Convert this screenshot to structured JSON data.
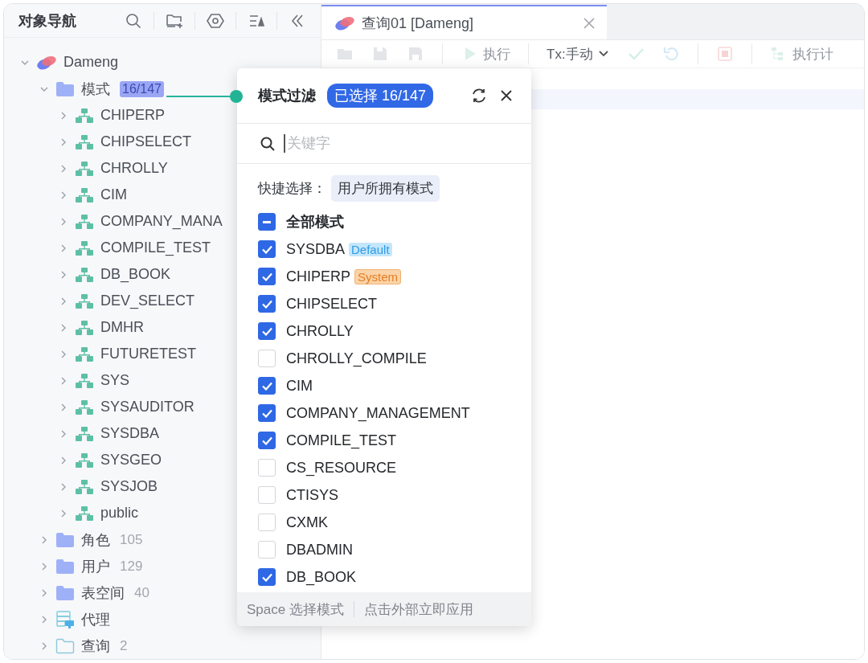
{
  "nav": {
    "title": "对象导航",
    "tree": [
      {
        "label": "Dameng",
        "kind": "database",
        "expanded": true,
        "children": [
          {
            "label": "模式",
            "kind": "folder",
            "badge": "16/147",
            "expanded": true,
            "children": [
              {
                "label": "CHIPERP",
                "kind": "schema",
                "expanded": false
              },
              {
                "label": "CHIPSELECT",
                "kind": "schema",
                "expanded": false
              },
              {
                "label": "CHROLLY",
                "kind": "schema",
                "expanded": false
              },
              {
                "label": "CIM",
                "kind": "schema",
                "expanded": false
              },
              {
                "label": "COMPANY_MANA",
                "kind": "schema",
                "expanded": false
              },
              {
                "label": "COMPILE_TEST",
                "kind": "schema",
                "expanded": false
              },
              {
                "label": "DB_BOOK",
                "kind": "schema",
                "expanded": false
              },
              {
                "label": "DEV_SELECT",
                "kind": "schema",
                "expanded": false
              },
              {
                "label": "DMHR",
                "kind": "schema",
                "expanded": false
              },
              {
                "label": "FUTURETEST",
                "kind": "schema",
                "expanded": false
              },
              {
                "label": "SYS",
                "kind": "schema",
                "expanded": false
              },
              {
                "label": "SYSAUDITOR",
                "kind": "schema",
                "expanded": false
              },
              {
                "label": "SYSDBA",
                "kind": "schema",
                "expanded": false
              },
              {
                "label": "SYSGEO",
                "kind": "schema",
                "expanded": false
              },
              {
                "label": "SYSJOB",
                "kind": "schema",
                "expanded": false
              },
              {
                "label": "public",
                "kind": "schema",
                "expanded": false
              }
            ]
          },
          {
            "label": "角色",
            "kind": "folder",
            "count": "105",
            "expanded": false
          },
          {
            "label": "用户",
            "kind": "folder",
            "count": "129",
            "expanded": false
          },
          {
            "label": "表空间",
            "kind": "folder",
            "count": "40",
            "expanded": false
          },
          {
            "label": "代理",
            "kind": "server",
            "expanded": false
          },
          {
            "label": "查询",
            "kind": "outline-folder",
            "count": "2",
            "expanded": false
          }
        ]
      }
    ]
  },
  "tabs": [
    {
      "label": "查询01 [Dameng]",
      "selected": true
    }
  ],
  "toolbar": [
    {
      "kind": "open",
      "disabled": true
    },
    {
      "kind": "save",
      "disabled": true
    },
    {
      "kind": "save-all",
      "disabled": true
    },
    {
      "kind": "run",
      "label": "执行",
      "disabled": true
    },
    {
      "kind": "tx",
      "label": "Tx:手动",
      "disabled": false
    },
    {
      "kind": "commit",
      "disabled": true
    },
    {
      "kind": "rollback",
      "disabled": true
    },
    {
      "kind": "stop",
      "disabled": true
    },
    {
      "kind": "plan",
      "label": "执行计",
      "disabled": true
    }
  ],
  "popup": {
    "title": "模式过滤",
    "badge": "已选择 16/147",
    "search": {
      "placeholder": "关键字"
    },
    "quick_label": "快捷选择：",
    "quick_options": [
      "用户所拥有模式"
    ],
    "all": {
      "label": "全部模式",
      "indeterminate": true
    },
    "items": [
      {
        "label": "SYSDBA",
        "checked": true,
        "tag": {
          "text": "Default",
          "kind": "default"
        }
      },
      {
        "label": "CHIPERP",
        "checked": true,
        "tag": {
          "text": "System",
          "kind": "system"
        }
      },
      {
        "label": "CHIPSELECT",
        "checked": true
      },
      {
        "label": "CHROLLY",
        "checked": true
      },
      {
        "label": "CHROLLY_COMPILE",
        "checked": false
      },
      {
        "label": "CIM",
        "checked": true
      },
      {
        "label": "COMPANY_MANAGEMENT",
        "checked": true
      },
      {
        "label": "COMPILE_TEST",
        "checked": true
      },
      {
        "label": "CS_RESOURCE",
        "checked": false
      },
      {
        "label": "CTISYS",
        "checked": false
      },
      {
        "label": "CXMK",
        "checked": false
      },
      {
        "label": "DBADMIN",
        "checked": false
      },
      {
        "label": "DB_BOOK",
        "checked": true
      }
    ],
    "footer": [
      "Space 选择模式",
      "点击外部立即应用"
    ]
  }
}
